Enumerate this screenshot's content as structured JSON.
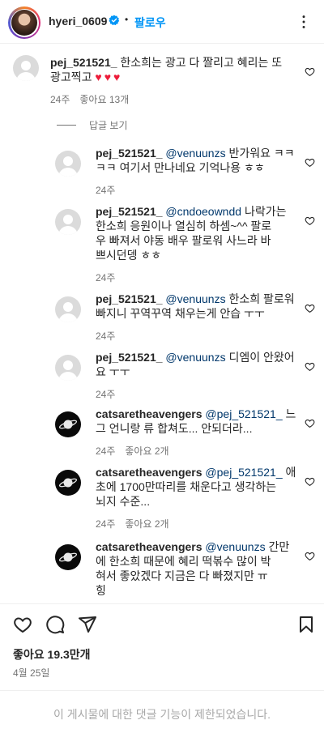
{
  "header": {
    "username": "hyeri_0609",
    "follow_label": "팔로우",
    "separator": "•"
  },
  "main_comment": {
    "username": "pej_521521_",
    "text": "한소희는 광고 다 짤리고 혜리는 또 광고찍고",
    "emoji": "♥♥♥",
    "time": "24주",
    "likes": "좋아요 13개",
    "view_replies": "답글 보기"
  },
  "replies": [
    {
      "username": "pej_521521_",
      "mention": "@venuunzs",
      "text_lines": [
        "반가워요 ㅋㅋ",
        "ㅋㅋ 여기서 만나네요 기억나용 ㅎㅎ"
      ],
      "time": "24주",
      "likes": "",
      "avatar": "default"
    },
    {
      "username": "pej_521521_",
      "mention": "@cndoeowndd",
      "text_lines": [
        "나락가는",
        "한소희 응원이나 열심히 하셈~^^ 팔로",
        "우 빠져서 야동 배우 팔로워 사느라 바",
        "쁘시던뎅 ㅎㅎ"
      ],
      "time": "24주",
      "likes": "",
      "avatar": "default"
    },
    {
      "username": "pej_521521_",
      "mention": "@venuunzs",
      "text_lines": [
        "한소희 팔로워",
        "빠지니 꾸역꾸역 채우는게 안습 ㅜㅜ"
      ],
      "time": "24주",
      "likes": "",
      "avatar": "default"
    },
    {
      "username": "pej_521521_",
      "mention": "@venuunzs",
      "text_lines": [
        "디엠이 안왔어",
        "요 ㅜㅜ"
      ],
      "time": "24주",
      "likes": "",
      "avatar": "default"
    },
    {
      "username": "catsaretheavengers",
      "mention": "@pej_521521_",
      "text_lines": [
        "느",
        "그 언니랑 류 합쳐도... 안되더라..."
      ],
      "time": "24주",
      "likes": "좋아요 2개",
      "avatar": "saturn"
    },
    {
      "username": "catsaretheavengers",
      "mention": "@pej_521521_",
      "text_lines": [
        "애",
        "초에 1700만따리를 채운다고 생각하는",
        "뇌지 수준..."
      ],
      "time": "24주",
      "likes": "좋아요 2개",
      "avatar": "saturn"
    },
    {
      "username": "catsaretheavengers",
      "mention": "@venuunzs",
      "text_lines": [
        "간만",
        "에 한소희 때문에 혜리 떡볶수 많이 박",
        "혀서 좋았겠다 지금은 다 빠졌지만 ㅠ",
        "힝"
      ],
      "time": "",
      "likes": "",
      "avatar": "saturn"
    }
  ],
  "footer": {
    "likes_label": "좋아요 19.3만개",
    "date_label": "4월 25일",
    "restricted_label": "이 게시물에 대한 댓글 기능이 제한되었습니다."
  },
  "icons": {
    "verified": "verified-badge-icon",
    "more": "more-options-icon",
    "heart": "heart-outline-icon",
    "comment": "comment-icon",
    "share": "share-icon",
    "save": "bookmark-icon"
  },
  "colors": {
    "link": "#0095f6",
    "mention": "#00376b",
    "heart_emoji": "#ed1c3a",
    "meta": "#737373"
  }
}
